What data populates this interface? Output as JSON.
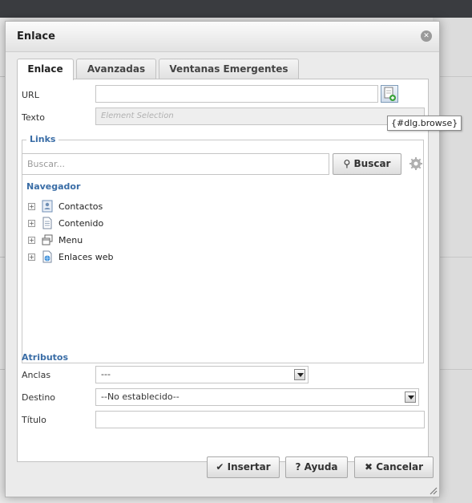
{
  "dialog": {
    "title": "Enlace",
    "close_icon": "close-icon"
  },
  "tabs": [
    {
      "label": "Enlace",
      "active": true
    },
    {
      "label": "Avanzadas",
      "active": false
    },
    {
      "label": "Ventanas Emergentes",
      "active": false
    }
  ],
  "form": {
    "url_label": "URL",
    "url_value": "",
    "text_label": "Texto",
    "text_placeholder": "Element Selection",
    "browse_tooltip": "{#dlg.browse}"
  },
  "links": {
    "legend": "Links",
    "search_placeholder": "Buscar...",
    "search_button": "Buscar",
    "navigator_heading": "Navegador",
    "tree": [
      {
        "label": "Contactos",
        "icon": "contacts-icon"
      },
      {
        "label": "Contenido",
        "icon": "document-icon"
      },
      {
        "label": "Menu",
        "icon": "menu-icon"
      },
      {
        "label": "Enlaces web",
        "icon": "weblinks-icon"
      }
    ]
  },
  "attributes": {
    "heading": "Atributos",
    "anchors_label": "Anclas",
    "anchors_value": "---",
    "target_label": "Destino",
    "target_value": "--No establecido--",
    "title_label": "Título",
    "title_value": ""
  },
  "footer": {
    "insert_label": "Insertar",
    "help_label": "Ayuda",
    "cancel_label": "Cancelar"
  },
  "colors": {
    "accent": "#3a6da6",
    "header_bar": "#3a3c40"
  }
}
